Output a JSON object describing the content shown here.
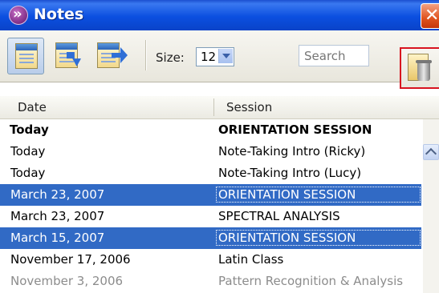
{
  "window": {
    "title": "Notes"
  },
  "toolbar": {
    "size_label": "Size:",
    "size_value": "12",
    "search_placeholder": "Search",
    "buttons": [
      "notes-view-icon",
      "import-icon",
      "export-icon",
      "trash-icon"
    ]
  },
  "columns": {
    "date": "Date",
    "session": "Session"
  },
  "rows": [
    {
      "date": "Today",
      "session": "ORIENTATION SESSION"
    },
    {
      "date": "Today",
      "session": "Note-Taking Intro (Ricky)"
    },
    {
      "date": "Today",
      "session": "Note-Taking Intro (Lucy)"
    },
    {
      "date": "March 23, 2007",
      "session": "ORIENTATION SESSION"
    },
    {
      "date": "March 23, 2007",
      "session": "SPECTRAL ANALYSIS"
    },
    {
      "date": "March 15, 2007",
      "session": "ORIENTATION SESSION"
    },
    {
      "date": "November 17, 2006",
      "session": "Latin Class"
    },
    {
      "date": "November 3, 2006",
      "session": "Pattern Recognition & Analysis"
    }
  ],
  "colors": {
    "selection": "#316ac5",
    "titlebar": "#0a4fe0",
    "close": "#e0531f",
    "highlight_border": "#d8131f"
  }
}
